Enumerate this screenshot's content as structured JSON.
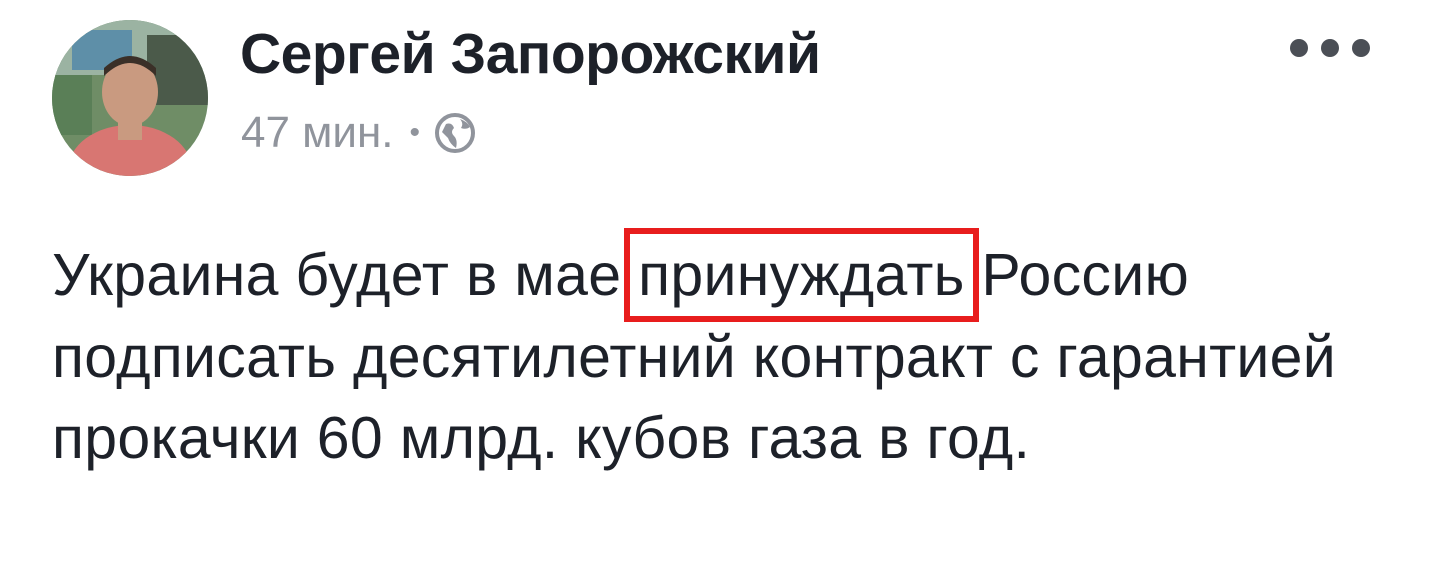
{
  "post": {
    "author_name": "Сергей Запорожский",
    "timestamp": "47 мин.",
    "separator": "•",
    "privacy_icon": "globe-icon",
    "more_icon": "more-options-icon",
    "text": {
      "before": "Украина будет в мае",
      "highlighted": "принуждать",
      "after": "Россию подписать десятилетний контракт с гарантией прокачки 60 млрд. кубов газа в год."
    },
    "highlight_color": "#e81d1d",
    "name_color": "#1d2129",
    "meta_color": "#90949c"
  }
}
